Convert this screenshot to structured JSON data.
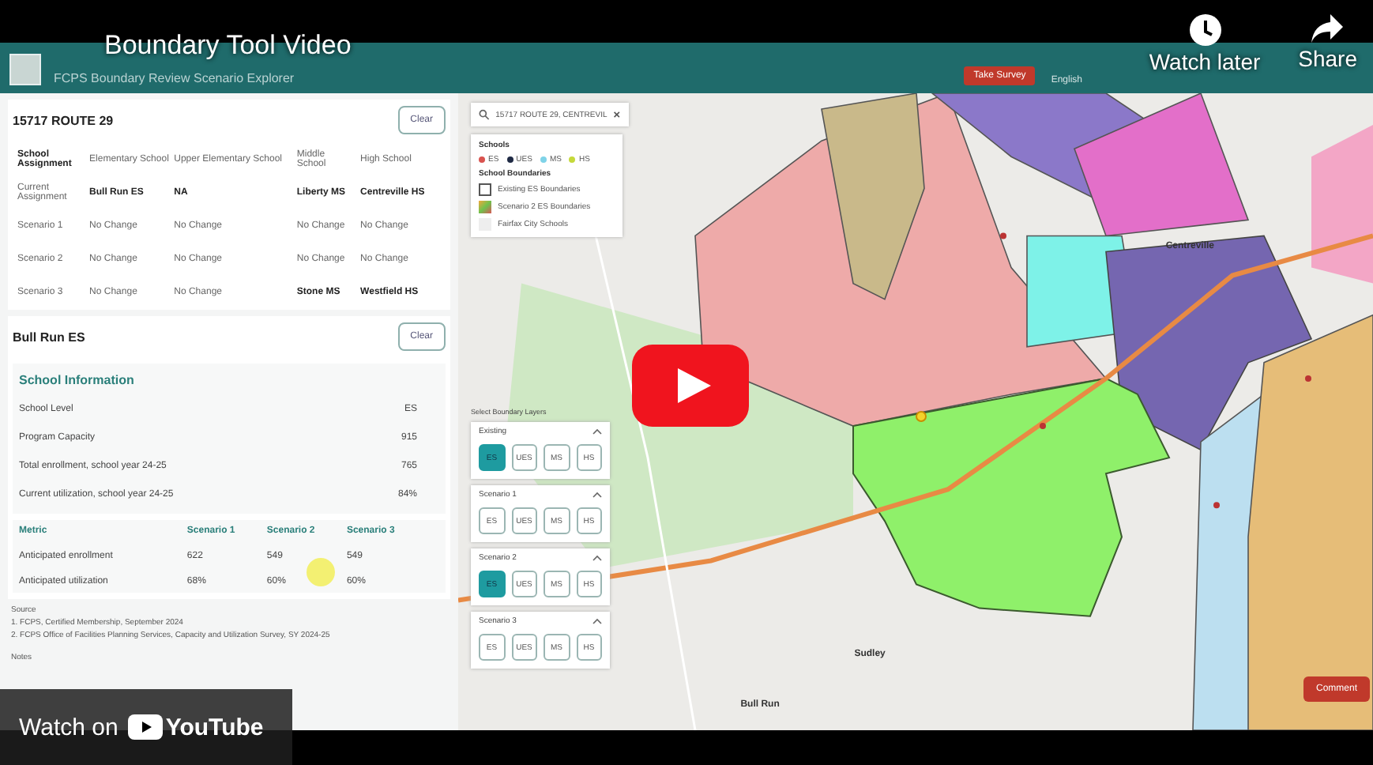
{
  "player": {
    "title": "Boundary Tool Video",
    "watch_later": "Watch later",
    "share": "Share",
    "watch_on": "Watch on",
    "youtube": "YouTube"
  },
  "app": {
    "subtitle": "FCPS Boundary Review Scenario Explorer",
    "take_survey": "Take Survey",
    "language": "English"
  },
  "address_card": {
    "title": "15717 ROUTE 29",
    "clear": "Clear",
    "columns": [
      "School Assignment",
      "Elementary School",
      "Upper Elementary School",
      "Middle School",
      "High School"
    ],
    "rows": [
      {
        "cells": [
          {
            "text": "Current Assignment",
            "bold": false
          },
          {
            "text": "Bull Run ES",
            "bold": true
          },
          {
            "text": "NA",
            "bold": true
          },
          {
            "text": "Liberty MS",
            "bold": true
          },
          {
            "text": "Centreville HS",
            "bold": true
          }
        ]
      },
      {
        "cells": [
          {
            "text": "Scenario 1",
            "bold": false
          },
          {
            "text": "No Change",
            "bold": false
          },
          {
            "text": "No Change",
            "bold": false
          },
          {
            "text": "No Change",
            "bold": false
          },
          {
            "text": "No Change",
            "bold": false
          }
        ]
      },
      {
        "cells": [
          {
            "text": "Scenario 2",
            "bold": false
          },
          {
            "text": "No Change",
            "bold": false
          },
          {
            "text": "No Change",
            "bold": false
          },
          {
            "text": "No Change",
            "bold": false
          },
          {
            "text": "No Change",
            "bold": false
          }
        ]
      },
      {
        "cells": [
          {
            "text": "Scenario 3",
            "bold": false
          },
          {
            "text": "No Change",
            "bold": false
          },
          {
            "text": "No Change",
            "bold": false
          },
          {
            "text": "Stone MS",
            "bold": true
          },
          {
            "text": "Westfield HS",
            "bold": true
          }
        ]
      }
    ]
  },
  "school_card": {
    "title": "Bull Run ES",
    "clear": "Clear",
    "section": "School Information",
    "info": [
      {
        "label": "School Level",
        "value": "ES"
      },
      {
        "label": "Program Capacity",
        "value": "915"
      },
      {
        "label": "Total enrollment, school year 24-25",
        "value": "765"
      },
      {
        "label": "Current utilization, school year 24-25",
        "value": "84%"
      }
    ],
    "metric_columns": [
      "Metric",
      "Scenario 1",
      "Scenario 2",
      "Scenario 3"
    ],
    "metric_rows": [
      [
        "Anticipated enrollment",
        "622",
        "549",
        "549"
      ],
      [
        "Anticipated utilization",
        "68%",
        "60%",
        "60%"
      ]
    ]
  },
  "source": {
    "heading": "Source",
    "items": [
      "1. FCPS, Certified Membership, September 2024",
      "2. FCPS Office of Facilities Planning Services, Capacity and Utilization Survey, SY 2024-25"
    ]
  },
  "notes": {
    "heading": "Notes"
  },
  "map": {
    "search": "15717 ROUTE 29, CENTREVIL",
    "legend": {
      "schools_heading": "Schools",
      "schools": [
        {
          "label": "ES",
          "color": "#d9534f"
        },
        {
          "label": "UES",
          "color": "#1f2a44"
        },
        {
          "label": "MS",
          "color": "#7fd3e8"
        },
        {
          "label": "HS",
          "color": "#c5d93a"
        }
      ],
      "boundaries_heading": "School Boundaries",
      "layers": [
        {
          "label": "Existing ES Boundaries",
          "kind": "outline"
        },
        {
          "label": "Scenario 2 ES Boundaries",
          "kind": "fill"
        },
        {
          "label": "Fairfax City Schools",
          "kind": "plain"
        }
      ]
    },
    "layer_panel": {
      "title": "Select Boundary Layers",
      "groups": [
        {
          "name": "Existing",
          "buttons": [
            {
              "label": "ES",
              "selected": true
            },
            {
              "label": "UES",
              "selected": false
            },
            {
              "label": "MS",
              "selected": false
            },
            {
              "label": "HS",
              "selected": false
            }
          ]
        },
        {
          "name": "Scenario 1",
          "buttons": [
            {
              "label": "ES",
              "selected": false
            },
            {
              "label": "UES",
              "selected": false
            },
            {
              "label": "MS",
              "selected": false
            },
            {
              "label": "HS",
              "selected": false
            }
          ]
        },
        {
          "name": "Scenario 2",
          "buttons": [
            {
              "label": "ES",
              "selected": true
            },
            {
              "label": "UES",
              "selected": false
            },
            {
              "label": "MS",
              "selected": false
            },
            {
              "label": "HS",
              "selected": false
            }
          ]
        },
        {
          "name": "Scenario 3",
          "buttons": [
            {
              "label": "ES",
              "selected": false
            },
            {
              "label": "UES",
              "selected": false
            },
            {
              "label": "MS",
              "selected": false
            },
            {
              "label": "HS",
              "selected": false
            }
          ]
        }
      ]
    },
    "places": [
      "Centreville",
      "Sudley",
      "Bull Run"
    ],
    "comment": "Comment"
  }
}
